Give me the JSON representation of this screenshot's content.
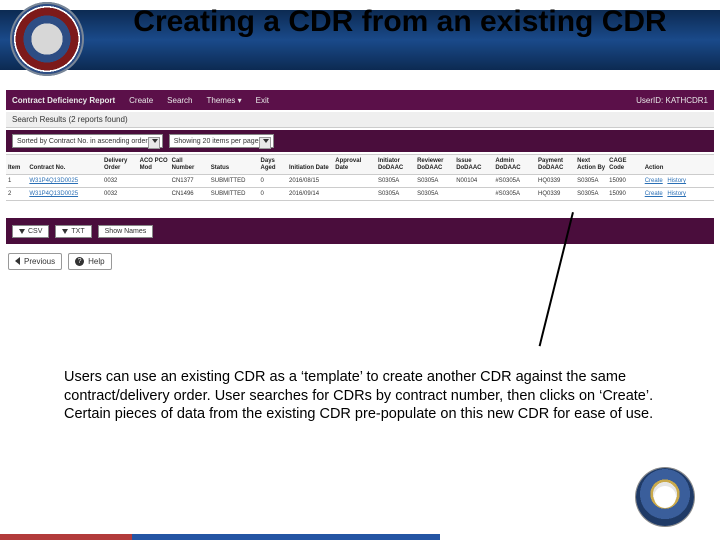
{
  "slide": {
    "title": "Creating a CDR from an existing CDR",
    "caption": "Users can use an existing CDR as a ‘template’ to create another CDR against the same  contract/delivery order.  User searches for CDRs by contract number, then clicks on ‘Create’. Certain pieces of data from the existing CDR pre-populate on this new CDR for ease of use."
  },
  "appbar": {
    "brand": "Contract Deficiency Report",
    "menu": [
      "Create",
      "Search",
      "Themes ▾",
      "Exit"
    ],
    "user_label": "UserID: KATHCDR1"
  },
  "subheader": "Search Results (2 reports found)",
  "filters": {
    "sort_label": "Sorted by Contract No. in ascending order",
    "page_label": "Showing 20 items per page"
  },
  "table": {
    "headers": [
      "Item",
      "Contract No.",
      "Delivery Order",
      "ACO PCO Mod",
      "Call Number",
      "Status",
      "Days Aged",
      "Initiation Date",
      "Approval Date",
      "Initiator DoDAAC",
      "Reviewer DoDAAC",
      "Issue DoDAAC",
      "Admin DoDAAC",
      "Payment DoDAAC",
      "Next Action By",
      "CAGE Code",
      "Action"
    ],
    "rows": [
      {
        "item": "1",
        "contract": "W31P4Q13D0025",
        "dorder": "0032",
        "mod": "",
        "call": "CN1377",
        "status": "SUBMITTED",
        "days": "0",
        "idate": "2016/08/15",
        "adate": "",
        "init": "S0305A",
        "rev": "S0305A",
        "iss": "N00104",
        "adm": "#S0305A",
        "pay": "HQ0339",
        "nab": "S0305A",
        "cage": "15090",
        "a1": "Create",
        "a2": "History"
      },
      {
        "item": "2",
        "contract": "W31P4Q13D0025",
        "dorder": "0032",
        "mod": "",
        "call": "CN1496",
        "status": "SUBMITTED",
        "days": "0",
        "idate": "2016/09/14",
        "adate": "",
        "init": "S0305A",
        "rev": "S0305A",
        "iss": "",
        "adm": "#S0305A",
        "pay": "HQ0339",
        "nab": "S0305A",
        "cage": "15090",
        "a1": "Create",
        "a2": "History"
      }
    ]
  },
  "buttons": {
    "csv": "CSV",
    "txt": "TXT",
    "shownames": "Show Names",
    "previous": "Previous",
    "help": "Help"
  }
}
